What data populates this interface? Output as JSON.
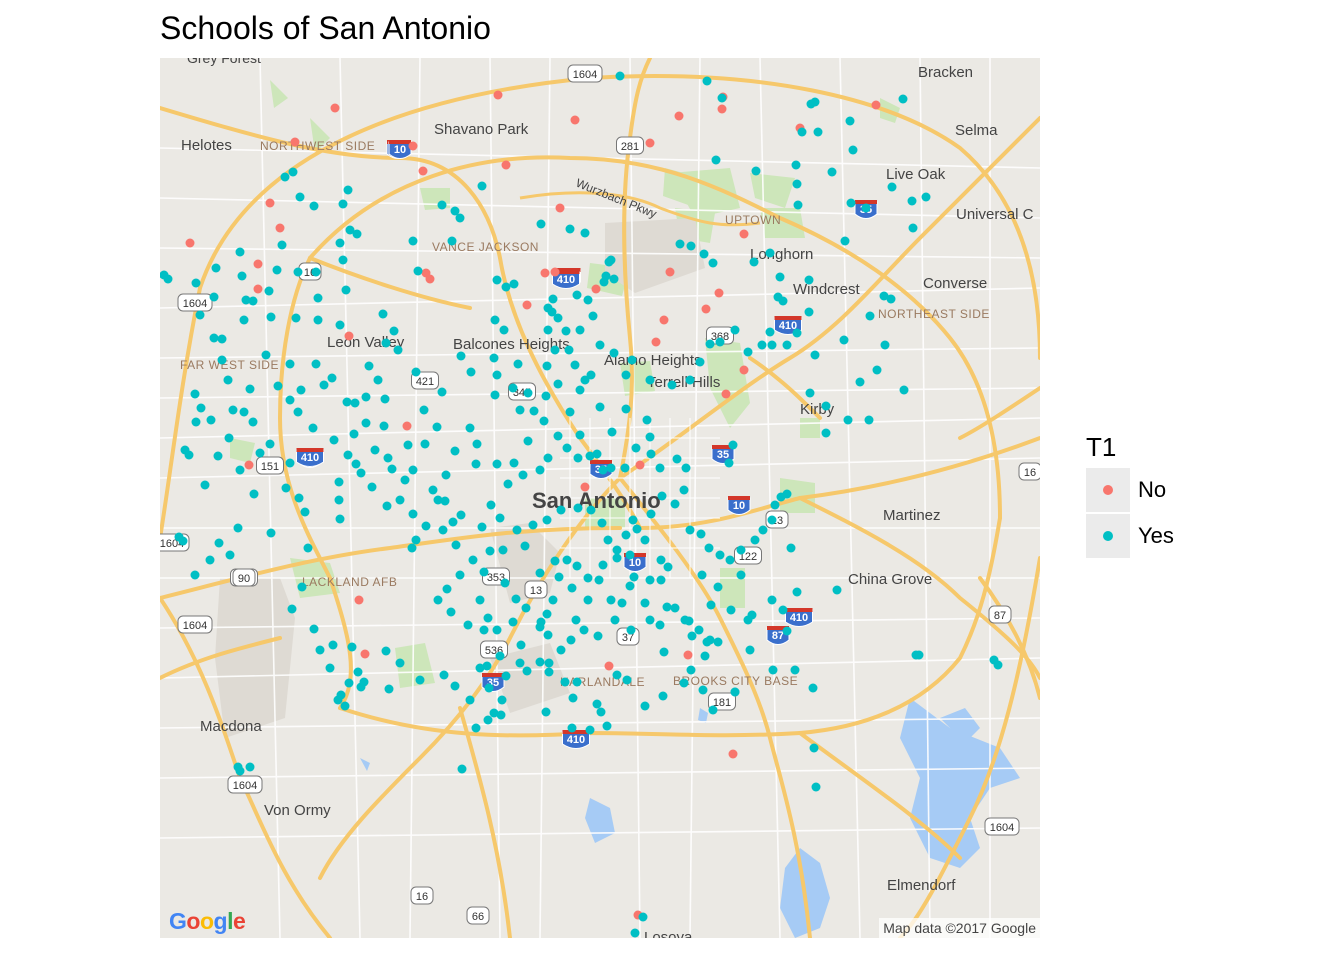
{
  "title": "Schools of San Antonio",
  "colors": {
    "no": "#f8766d",
    "yes": "#00bfc4",
    "map_bg": "#ebe9e4",
    "highway": "#f6c86b",
    "water": "#a6cbf5",
    "park": "#cde6ba"
  },
  "legend": {
    "title": "T1",
    "items": [
      {
        "label": "No",
        "color": "#f8766d"
      },
      {
        "label": "Yes",
        "color": "#00bfc4"
      }
    ]
  },
  "map": {
    "google_logo": "Google",
    "attribution": "Map data ©2017 Google",
    "city_label": "San Antonio",
    "places": [
      "Grey Forest",
      "Bracken",
      "Shavano Park",
      "Selma",
      "Helotes",
      "Live Oak",
      "Universal C",
      "Longhorn",
      "Converse",
      "Windcrest",
      "Leon Valley",
      "Balcones Heights",
      "Alamo Heights",
      "Terrell Hills",
      "Kirby",
      "Martinez",
      "China Grove",
      "Macdona",
      "Von Ormy",
      "Elmendorf",
      "Losoya"
    ],
    "districts": [
      "NORTHWEST SIDE",
      "UPTOWN",
      "VANCE JACKSON",
      "NORTHEAST SIDE",
      "FAR WEST SIDE",
      "LACKLAND AFB",
      "HARLANDALE",
      "BROOKS CITY BASE"
    ],
    "road_label": "Wurzbach Pkwy",
    "highway_shields": [
      "1604",
      "281",
      "10",
      "35",
      "410",
      "16",
      "368",
      "421",
      "345",
      "151",
      "90",
      "371",
      "353",
      "13",
      "536",
      "37",
      "87",
      "122",
      "181",
      "66",
      "16",
      "1604",
      "1604",
      "1604",
      "1604",
      "1604",
      "410",
      "410",
      "410",
      "410",
      "410",
      "10",
      "10",
      "10",
      "35",
      "35",
      "35",
      "35",
      "90",
      "13",
      "87",
      "16"
    ]
  },
  "schools_no": [
    [
      335,
      108
    ],
    [
      498,
      95
    ],
    [
      575,
      120
    ],
    [
      295,
      142
    ],
    [
      413,
      146
    ],
    [
      423,
      171
    ],
    [
      506,
      165
    ],
    [
      650,
      143
    ],
    [
      679,
      116
    ],
    [
      723,
      97
    ],
    [
      722,
      109
    ],
    [
      876,
      105
    ],
    [
      800,
      128
    ],
    [
      270,
      203
    ],
    [
      280,
      228
    ],
    [
      190,
      243
    ],
    [
      258,
      264
    ],
    [
      258,
      289
    ],
    [
      426,
      273
    ],
    [
      430,
      279
    ],
    [
      560,
      208
    ],
    [
      545,
      273
    ],
    [
      555,
      272
    ],
    [
      527,
      305
    ],
    [
      596,
      289
    ],
    [
      744,
      234
    ],
    [
      670,
      272
    ],
    [
      664,
      320
    ],
    [
      706,
      309
    ],
    [
      719,
      293
    ],
    [
      349,
      336
    ],
    [
      656,
      342
    ],
    [
      744,
      370
    ],
    [
      726,
      394
    ],
    [
      407,
      426
    ],
    [
      249,
      465
    ],
    [
      585,
      487
    ],
    [
      640,
      465
    ],
    [
      359,
      600
    ],
    [
      365,
      654
    ],
    [
      609,
      666
    ],
    [
      688,
      655
    ],
    [
      733,
      754
    ],
    [
      638,
      915
    ]
  ],
  "schools_yes": [
    [
      620,
      76
    ],
    [
      707,
      81
    ],
    [
      722,
      98
    ],
    [
      811,
      104
    ],
    [
      815,
      102
    ],
    [
      802,
      132
    ],
    [
      818,
      132
    ],
    [
      850,
      121
    ],
    [
      853,
      150
    ],
    [
      832,
      172
    ],
    [
      796,
      165
    ],
    [
      797,
      184
    ],
    [
      798,
      205
    ],
    [
      851,
      203
    ],
    [
      866,
      208
    ],
    [
      903,
      99
    ],
    [
      892,
      187
    ],
    [
      926,
      197
    ],
    [
      912,
      201
    ],
    [
      913,
      228
    ],
    [
      716,
      160
    ],
    [
      756,
      171
    ],
    [
      455,
      211
    ],
    [
      442,
      205
    ],
    [
      460,
      218
    ],
    [
      452,
      241
    ],
    [
      541,
      224
    ],
    [
      570,
      229
    ],
    [
      585,
      233
    ],
    [
      611,
      260
    ],
    [
      609,
      262
    ],
    [
      604,
      282
    ],
    [
      606,
      276
    ],
    [
      614,
      279
    ],
    [
      680,
      244
    ],
    [
      691,
      246
    ],
    [
      704,
      254
    ],
    [
      713,
      263
    ],
    [
      754,
      262
    ],
    [
      770,
      253
    ],
    [
      780,
      277
    ],
    [
      809,
      280
    ],
    [
      845,
      241
    ],
    [
      778,
      297
    ],
    [
      783,
      301
    ],
    [
      809,
      312
    ],
    [
      870,
      316
    ],
    [
      884,
      296
    ],
    [
      891,
      299
    ],
    [
      348,
      190
    ],
    [
      343,
      204
    ],
    [
      350,
      230
    ],
    [
      357,
      234
    ],
    [
      300,
      197
    ],
    [
      314,
      206
    ],
    [
      285,
      177
    ],
    [
      293,
      172
    ],
    [
      240,
      252
    ],
    [
      216,
      268
    ],
    [
      242,
      276
    ],
    [
      196,
      283
    ],
    [
      214,
      297
    ],
    [
      200,
      315
    ],
    [
      214,
      338
    ],
    [
      222,
      339
    ],
    [
      164,
      275
    ],
    [
      168,
      279
    ],
    [
      189,
      455
    ],
    [
      183,
      541
    ],
    [
      179,
      537
    ],
    [
      210,
      560
    ],
    [
      195,
      575
    ],
    [
      238,
      528
    ],
    [
      254,
      494
    ],
    [
      271,
      533
    ],
    [
      286,
      488
    ],
    [
      299,
      498
    ],
    [
      305,
      512
    ],
    [
      339,
      482
    ],
    [
      339,
      500
    ],
    [
      340,
      519
    ],
    [
      308,
      548
    ],
    [
      302,
      587
    ],
    [
      292,
      609
    ],
    [
      314,
      629
    ],
    [
      333,
      645
    ],
    [
      352,
      647
    ],
    [
      358,
      672
    ],
    [
      361,
      687
    ],
    [
      338,
      700
    ],
    [
      345,
      706
    ],
    [
      389,
      689
    ],
    [
      412,
      548
    ],
    [
      426,
      526
    ],
    [
      443,
      530
    ],
    [
      453,
      522
    ],
    [
      413,
      241
    ],
    [
      418,
      271
    ],
    [
      482,
      186
    ],
    [
      497,
      280
    ],
    [
      506,
      287
    ],
    [
      514,
      284
    ],
    [
      495,
      320
    ],
    [
      504,
      330
    ],
    [
      383,
      314
    ],
    [
      394,
      331
    ],
    [
      386,
      343
    ],
    [
      398,
      350
    ],
    [
      369,
      366
    ],
    [
      378,
      380
    ],
    [
      385,
      399
    ],
    [
      366,
      397
    ],
    [
      354,
      434
    ],
    [
      384,
      426
    ],
    [
      408,
      445
    ],
    [
      425,
      444
    ],
    [
      437,
      427
    ],
    [
      424,
      410
    ],
    [
      442,
      392
    ],
    [
      416,
      372
    ],
    [
      461,
      356
    ],
    [
      471,
      372
    ],
    [
      494,
      358
    ],
    [
      497,
      375
    ],
    [
      495,
      395
    ],
    [
      513,
      388
    ],
    [
      520,
      410
    ],
    [
      534,
      411
    ],
    [
      544,
      421
    ],
    [
      528,
      441
    ],
    [
      514,
      463
    ],
    [
      497,
      464
    ],
    [
      476,
      464
    ],
    [
      477,
      444
    ],
    [
      470,
      428
    ],
    [
      455,
      451
    ],
    [
      446,
      475
    ],
    [
      433,
      490
    ],
    [
      413,
      470
    ],
    [
      405,
      480
    ],
    [
      388,
      458
    ],
    [
      361,
      473
    ],
    [
      356,
      464
    ],
    [
      372,
      487
    ],
    [
      387,
      506
    ],
    [
      400,
      500
    ],
    [
      413,
      514
    ],
    [
      438,
      500
    ],
    [
      445,
      501
    ],
    [
      461,
      515
    ],
    [
      482,
      527
    ],
    [
      491,
      505
    ],
    [
      500,
      518
    ],
    [
      508,
      484
    ],
    [
      523,
      475
    ],
    [
      540,
      470
    ],
    [
      548,
      458
    ],
    [
      558,
      436
    ],
    [
      567,
      448
    ],
    [
      580,
      435
    ],
    [
      578,
      458
    ],
    [
      590,
      456
    ],
    [
      597,
      454
    ],
    [
      603,
      470
    ],
    [
      611,
      468
    ],
    [
      625,
      468
    ],
    [
      636,
      448
    ],
    [
      651,
      454
    ],
    [
      660,
      468
    ],
    [
      677,
      459
    ],
    [
      686,
      468
    ],
    [
      684,
      490
    ],
    [
      675,
      504
    ],
    [
      662,
      496
    ],
    [
      651,
      514
    ],
    [
      633,
      520
    ],
    [
      626,
      535
    ],
    [
      617,
      550
    ],
    [
      608,
      540
    ],
    [
      602,
      523
    ],
    [
      591,
      510
    ],
    [
      578,
      508
    ],
    [
      561,
      510
    ],
    [
      547,
      520
    ],
    [
      533,
      525
    ],
    [
      525,
      546
    ],
    [
      517,
      530
    ],
    [
      503,
      550
    ],
    [
      490,
      551
    ],
    [
      484,
      572
    ],
    [
      473,
      560
    ],
    [
      460,
      575
    ],
    [
      447,
      589
    ],
    [
      438,
      600
    ],
    [
      451,
      612
    ],
    [
      468,
      625
    ],
    [
      484,
      630
    ],
    [
      488,
      618
    ],
    [
      497,
      630
    ],
    [
      513,
      622
    ],
    [
      526,
      608
    ],
    [
      541,
      622
    ],
    [
      547,
      614
    ],
    [
      553,
      600
    ],
    [
      559,
      577
    ],
    [
      567,
      560
    ],
    [
      577,
      566
    ],
    [
      588,
      578
    ],
    [
      599,
      580
    ],
    [
      603,
      565
    ],
    [
      617,
      558
    ],
    [
      630,
      555
    ],
    [
      634,
      577
    ],
    [
      650,
      580
    ],
    [
      661,
      580
    ],
    [
      668,
      567
    ],
    [
      661,
      560
    ],
    [
      645,
      540
    ],
    [
      637,
      529
    ],
    [
      690,
      530
    ],
    [
      701,
      534
    ],
    [
      709,
      548
    ],
    [
      720,
      555
    ],
    [
      730,
      560
    ],
    [
      741,
      550
    ],
    [
      755,
      540
    ],
    [
      763,
      530
    ],
    [
      772,
      520
    ],
    [
      775,
      505
    ],
    [
      781,
      497
    ],
    [
      787,
      494
    ],
    [
      791,
      548
    ],
    [
      797,
      592
    ],
    [
      783,
      610
    ],
    [
      787,
      631
    ],
    [
      772,
      600
    ],
    [
      752,
      615
    ],
    [
      750,
      650
    ],
    [
      748,
      620
    ],
    [
      731,
      610
    ],
    [
      711,
      605
    ],
    [
      702,
      575
    ],
    [
      718,
      587
    ],
    [
      741,
      575
    ],
    [
      710,
      640
    ],
    [
      692,
      636
    ],
    [
      689,
      621
    ],
    [
      675,
      608
    ],
    [
      660,
      625
    ],
    [
      645,
      603
    ],
    [
      631,
      630
    ],
    [
      615,
      620
    ],
    [
      598,
      636
    ],
    [
      584,
      630
    ],
    [
      576,
      620
    ],
    [
      571,
      640
    ],
    [
      561,
      650
    ],
    [
      548,
      635
    ],
    [
      540,
      627
    ],
    [
      521,
      645
    ],
    [
      500,
      656
    ],
    [
      487,
      666
    ],
    [
      480,
      668
    ],
    [
      489,
      688
    ],
    [
      506,
      676
    ],
    [
      520,
      663
    ],
    [
      540,
      662
    ],
    [
      549,
      672
    ],
    [
      565,
      682
    ],
    [
      577,
      682
    ],
    [
      597,
      704
    ],
    [
      601,
      712
    ],
    [
      572,
      728
    ],
    [
      546,
      712
    ],
    [
      501,
      715
    ],
    [
      494,
      713
    ],
    [
      476,
      728
    ],
    [
      462,
      769
    ],
    [
      617,
      675
    ],
    [
      627,
      680
    ],
    [
      664,
      652
    ],
    [
      713,
      710
    ],
    [
      735,
      692
    ],
    [
      703,
      690
    ],
    [
      707,
      642
    ],
    [
      733,
      445
    ],
    [
      729,
      463
    ],
    [
      612,
      432
    ],
    [
      626,
      409
    ],
    [
      647,
      420
    ],
    [
      650,
      437
    ],
    [
      600,
      407
    ],
    [
      580,
      390
    ],
    [
      570,
      412
    ],
    [
      558,
      384
    ],
    [
      546,
      396
    ],
    [
      528,
      393
    ],
    [
      518,
      364
    ],
    [
      547,
      366
    ],
    [
      555,
      350
    ],
    [
      548,
      330
    ],
    [
      548,
      308
    ],
    [
      553,
      299
    ],
    [
      577,
      295
    ],
    [
      588,
      300
    ],
    [
      593,
      316
    ],
    [
      580,
      330
    ],
    [
      600,
      345
    ],
    [
      614,
      353
    ],
    [
      591,
      375
    ],
    [
      585,
      380
    ],
    [
      575,
      365
    ],
    [
      569,
      350
    ],
    [
      566,
      331
    ],
    [
      552,
      312
    ],
    [
      558,
      318
    ],
    [
      632,
      360
    ],
    [
      626,
      375
    ],
    [
      650,
      380
    ],
    [
      672,
      385
    ],
    [
      690,
      380
    ],
    [
      700,
      362
    ],
    [
      710,
      344
    ],
    [
      720,
      342
    ],
    [
      735,
      330
    ],
    [
      748,
      352
    ],
    [
      762,
      345
    ],
    [
      770,
      332
    ],
    [
      787,
      345
    ],
    [
      797,
      333
    ],
    [
      810,
      393
    ],
    [
      826,
      406
    ],
    [
      826,
      433
    ],
    [
      848,
      420
    ],
    [
      869,
      420
    ],
    [
      877,
      370
    ],
    [
      860,
      382
    ],
    [
      904,
      390
    ],
    [
      885,
      345
    ],
    [
      844,
      340
    ],
    [
      815,
      355
    ],
    [
      772,
      345
    ],
    [
      270,
      444
    ],
    [
      290,
      463
    ],
    [
      260,
      453
    ],
    [
      240,
      470
    ],
    [
      218,
      456
    ],
    [
      205,
      485
    ],
    [
      185,
      450
    ],
    [
      196,
      422
    ],
    [
      211,
      420
    ],
    [
      244,
      412
    ],
    [
      250,
      389
    ],
    [
      253,
      422
    ],
    [
      278,
      386
    ],
    [
      290,
      400
    ],
    [
      298,
      412
    ],
    [
      313,
      428
    ],
    [
      334,
      440
    ],
    [
      348,
      455
    ],
    [
      366,
      423
    ],
    [
      355,
      403
    ],
    [
      324,
      385
    ],
    [
      301,
      390
    ],
    [
      290,
      364
    ],
    [
      266,
      355
    ],
    [
      244,
      320
    ],
    [
      246,
      300
    ],
    [
      271,
      317
    ],
    [
      296,
      318
    ],
    [
      318,
      298
    ],
    [
      318,
      320
    ],
    [
      340,
      325
    ],
    [
      346,
      290
    ],
    [
      343,
      260
    ],
    [
      340,
      243
    ],
    [
      316,
      272
    ],
    [
      298,
      272
    ],
    [
      282,
      245
    ],
    [
      277,
      270
    ],
    [
      269,
      291
    ],
    [
      253,
      301
    ],
    [
      222,
      360
    ],
    [
      228,
      380
    ],
    [
      195,
      394
    ],
    [
      201,
      408
    ],
    [
      233,
      410
    ],
    [
      229,
      438
    ],
    [
      219,
      543
    ],
    [
      230,
      555
    ],
    [
      316,
      364
    ],
    [
      332,
      378
    ],
    [
      347,
      402
    ],
    [
      375,
      450
    ],
    [
      392,
      469
    ],
    [
      416,
      540
    ],
    [
      456,
      545
    ],
    [
      480,
      600
    ],
    [
      505,
      583
    ],
    [
      516,
      599
    ],
    [
      540,
      573
    ],
    [
      555,
      561
    ],
    [
      572,
      588
    ],
    [
      588,
      600
    ],
    [
      611,
      600
    ],
    [
      622,
      603
    ],
    [
      630,
      586
    ],
    [
      650,
      620
    ],
    [
      667,
      607
    ],
    [
      685,
      620
    ],
    [
      699,
      630
    ],
    [
      773,
      670
    ],
    [
      795,
      670
    ],
    [
      813,
      688
    ],
    [
      837,
      590
    ],
    [
      916,
      655
    ],
    [
      919,
      655
    ],
    [
      994,
      660
    ],
    [
      998,
      665
    ],
    [
      814,
      748
    ],
    [
      816,
      787
    ],
    [
      735,
      692
    ],
    [
      718,
      642
    ],
    [
      705,
      656
    ],
    [
      691,
      670
    ],
    [
      684,
      683
    ],
    [
      663,
      696
    ],
    [
      645,
      706
    ],
    [
      607,
      726
    ],
    [
      590,
      730
    ],
    [
      573,
      698
    ],
    [
      549,
      663
    ],
    [
      527,
      671
    ],
    [
      502,
      700
    ],
    [
      488,
      720
    ],
    [
      470,
      700
    ],
    [
      455,
      686
    ],
    [
      444,
      675
    ],
    [
      420,
      680
    ],
    [
      400,
      663
    ],
    [
      386,
      651
    ],
    [
      364,
      682
    ],
    [
      349,
      683
    ],
    [
      341,
      695
    ],
    [
      330,
      668
    ],
    [
      320,
      650
    ],
    [
      238,
      767
    ],
    [
      250,
      767
    ],
    [
      240,
      771
    ],
    [
      635,
      933
    ],
    [
      643,
      917
    ]
  ]
}
